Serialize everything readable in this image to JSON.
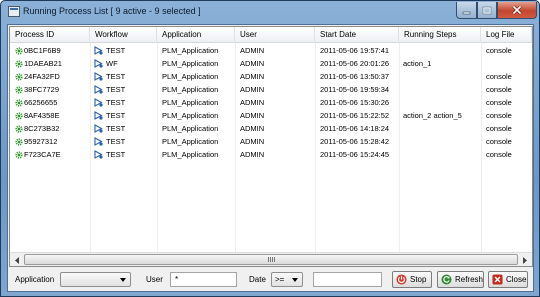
{
  "window": {
    "title": "Running Process List [ 9 active - 9 selected ]"
  },
  "columns": [
    "Process ID",
    "Workflow",
    "Application",
    "User",
    "Start Date",
    "Running Steps",
    "Log File"
  ],
  "rows": [
    {
      "process_id": "0BC1F6B9",
      "workflow": "TEST",
      "application": "PLM_Application",
      "user": "ADMIN",
      "start_date": "2011-05-06 19:57:41",
      "running_steps": "",
      "log_file": "console"
    },
    {
      "process_id": "1DAEAB21",
      "workflow": "WF",
      "application": "PLM_Application",
      "user": "ADMIN",
      "start_date": "2011-05-06 20:01:26",
      "running_steps": "action_1",
      "log_file": ""
    },
    {
      "process_id": "24FA32FD",
      "workflow": "TEST",
      "application": "PLM_Application",
      "user": "ADMIN",
      "start_date": "2011-05-06 13:50:37",
      "running_steps": "",
      "log_file": "console"
    },
    {
      "process_id": "38FC7729",
      "workflow": "TEST",
      "application": "PLM_Application",
      "user": "ADMIN",
      "start_date": "2011-05-06 19:59:34",
      "running_steps": "",
      "log_file": "console"
    },
    {
      "process_id": "66256655",
      "workflow": "TEST",
      "application": "PLM_Application",
      "user": "ADMIN",
      "start_date": "2011-05-06 15:30:26",
      "running_steps": "",
      "log_file": "console"
    },
    {
      "process_id": "8AF4358E",
      "workflow": "TEST",
      "application": "PLM_Application",
      "user": "ADMIN",
      "start_date": "2011-05-06 15:22:52",
      "running_steps": "action_2 action_5",
      "log_file": "console"
    },
    {
      "process_id": "8C273B32",
      "workflow": "TEST",
      "application": "PLM_Application",
      "user": "ADMIN",
      "start_date": "2011-05-06 14:18:24",
      "running_steps": "",
      "log_file": "console"
    },
    {
      "process_id": "95927312",
      "workflow": "TEST",
      "application": "PLM_Application",
      "user": "ADMIN",
      "start_date": "2011-05-06 15:28:42",
      "running_steps": "",
      "log_file": "console"
    },
    {
      "process_id": "F723CA7E",
      "workflow": "TEST",
      "application": "PLM_Application",
      "user": "ADMIN",
      "start_date": "2011-05-06 15:24:45",
      "running_steps": "",
      "log_file": "console"
    }
  ],
  "filters": {
    "application_label": "Application",
    "application_value": "",
    "user_label": "User",
    "user_value": "*",
    "date_label": "Date",
    "date_operator": ">=",
    "date_value": ""
  },
  "buttons": {
    "stop": "Stop",
    "refresh": "Refresh",
    "close": "Close"
  },
  "icons": {
    "process": "gear-icon",
    "workflow": "workflow-icon",
    "stop": "stop-icon",
    "refresh": "refresh-icon",
    "close": "close-icon"
  },
  "colors": {
    "process_icon": "#2e9b2e",
    "workflow_icon": "#2b5fa8",
    "stop_icon": "#d23a2a",
    "refresh_icon": "#2e8a34",
    "close_icon": "#c8281e"
  }
}
